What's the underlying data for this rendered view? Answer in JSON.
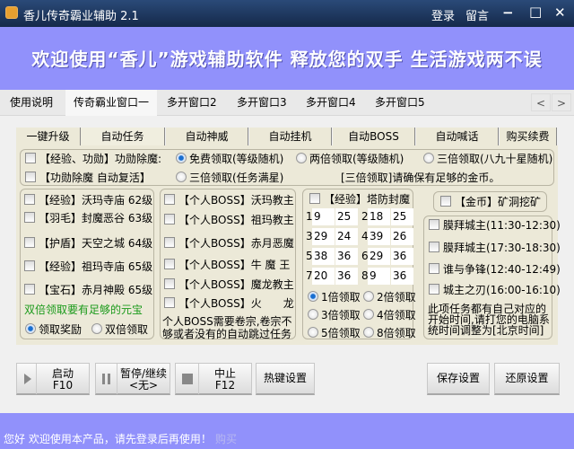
{
  "window": {
    "title": "香儿传奇霸业辅助 2.1",
    "login": "登录",
    "message": "留言",
    "minimize": "−",
    "maximize": "□",
    "close": "✕"
  },
  "banner": "欢迎使用“香儿”游戏辅助软件 释放您的双手 生活游戏两不误",
  "main_tabs": [
    "使用说明",
    "传奇霸业窗口一",
    "多开窗口2",
    "多开窗口3",
    "多开窗口4",
    "多开窗口5"
  ],
  "main_tab_active": 1,
  "tab_scroll": {
    "left": "<",
    "right": ">"
  },
  "sub_tabs": [
    "一键升级",
    "自动任务",
    "自动神威",
    "自动挂机",
    "自动BOSS",
    "自动喊话",
    "购买续费"
  ],
  "sub_tab_active": 1,
  "top_group": {
    "cb1": "【经验、功勋】功勋除魔:",
    "cb2": "【功勋除魔 自动复活】",
    "r1": "免费领取(等级随机)",
    "r2": "两倍领取(等级随机)",
    "r3": "三倍领取(八九十星随机)",
    "r4": "三倍领取(任务满星)",
    "note": "[三倍领取]请确保有足够的金币。",
    "selected": "免费领取(等级随机)"
  },
  "left_group": {
    "items": [
      "【经验】沃玛寺庙 62级",
      "【羽毛】封魔恶谷 63级",
      "【护盾】天空之城 64级",
      "【经验】祖玛寺庙 65级",
      "【宝石】赤月神殿 65级"
    ],
    "warning": "双倍领取要有足够的元宝",
    "warning_color": "#1a9a1a",
    "r1": "领取奖励",
    "r2": "双倍领取",
    "selected": "领取奖励"
  },
  "boss_group": {
    "items": [
      "【个人BOSS】沃玛教主",
      "【个人BOSS】祖玛教主",
      "【个人BOSS】赤月恶魔",
      "【个人BOSS】牛 魔 王",
      "【个人BOSS】魔龙教主",
      "【个人BOSS】火　　龙"
    ],
    "note1": "个人BOSS需要卷宗,卷宗不",
    "note2": "够或者没有的自动跳过任务"
  },
  "tower_group": {
    "title": "【经验】塔防封魔",
    "slots": [
      {
        "n": "1",
        "a": "9",
        "b": "25"
      },
      {
        "n": "2",
        "a": "18",
        "b": "25"
      },
      {
        "n": "3",
        "a": "29",
        "b": "24"
      },
      {
        "n": "4",
        "a": "39",
        "b": "26"
      },
      {
        "n": "5",
        "a": "38",
        "b": "36"
      },
      {
        "n": "6",
        "a": "29",
        "b": "36"
      },
      {
        "n": "7",
        "a": "20",
        "b": "36"
      },
      {
        "n": "8",
        "a": "9",
        "b": "36"
      }
    ],
    "multipliers": [
      "1倍领取",
      "2倍领取",
      "3倍领取",
      "4倍领取",
      "5倍领取",
      "8倍领取"
    ],
    "selected": "1倍领取"
  },
  "gold": {
    "label": "【金币】矿洞挖矿"
  },
  "city_group": {
    "items": [
      "膜拜城主(11:30-12:30)",
      "膜拜城主(17:30-18:30)",
      "谁与争锋(12:40-12:49)",
      "城主之刃(16:00-16:10)"
    ],
    "note": [
      "此项任务都有自己对应的",
      "开始时间,请打您的电脑系",
      "统时间调整为[北京时间]"
    ]
  },
  "buttons": {
    "start": "启动",
    "start_key": "F10",
    "pause": "暂停/继续",
    "pause_key": "<无>",
    "stop": "中止",
    "stop_key": "F12",
    "hotkey": "热键设置",
    "save": "保存设置",
    "restore": "还原设置"
  },
  "status": {
    "text": "您好 欢迎使用本产品，请先登录后再使用！",
    "buy": "购买"
  }
}
